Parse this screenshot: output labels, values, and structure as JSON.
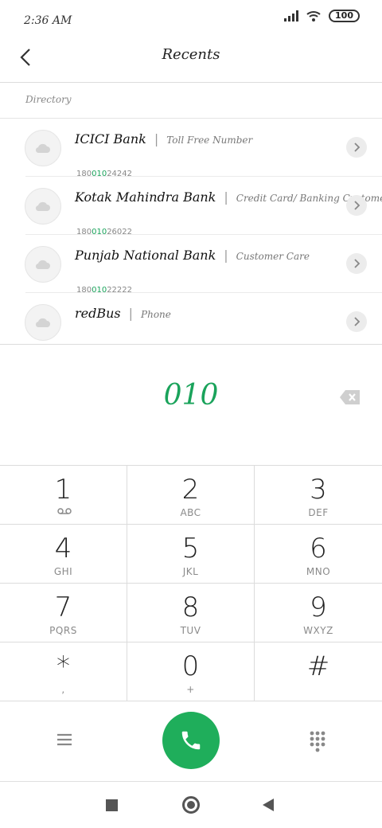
{
  "status_bar": {
    "time": "2:36 AM",
    "battery": "100"
  },
  "header": {
    "title": "Recents"
  },
  "directory": {
    "label": "Directory",
    "results": [
      {
        "name": "ICICI Bank",
        "type": "Toll Free Number",
        "number_prefix": "180",
        "number_match": "010",
        "number_suffix": "24242"
      },
      {
        "name": "Kotak Mahindra Bank",
        "type": "Credit Card/ Banking Customer Service",
        "number_prefix": "180",
        "number_match": "010",
        "number_suffix": "26022"
      },
      {
        "name": "Punjab National Bank",
        "type": "Customer Care",
        "number_prefix": "180",
        "number_match": "010",
        "number_suffix": "22222"
      },
      {
        "name": "redBus",
        "type": "Phone",
        "number_prefix": "",
        "number_match": "",
        "number_suffix": ""
      }
    ]
  },
  "dialer": {
    "typed_number": "010",
    "keys": [
      {
        "digit": "1",
        "letters": ""
      },
      {
        "digit": "2",
        "letters": "ABC"
      },
      {
        "digit": "3",
        "letters": "DEF"
      },
      {
        "digit": "4",
        "letters": "GHI"
      },
      {
        "digit": "5",
        "letters": "JKL"
      },
      {
        "digit": "6",
        "letters": "MNO"
      },
      {
        "digit": "7",
        "letters": "PQRS"
      },
      {
        "digit": "8",
        "letters": "TUV"
      },
      {
        "digit": "9",
        "letters": "WXYZ"
      },
      {
        "digit": "*",
        "letters": ","
      },
      {
        "digit": "0",
        "letters": "+"
      },
      {
        "digit": "#",
        "letters": ""
      }
    ]
  },
  "colors": {
    "accent": "#1aa35b",
    "call_button": "#1fae5b"
  },
  "icons": [
    "back-arrow-icon",
    "cloud-icon",
    "chevron-right-icon",
    "backspace-icon",
    "voicemail-icon",
    "menu-icon",
    "phone-icon",
    "keypad-icon"
  ]
}
